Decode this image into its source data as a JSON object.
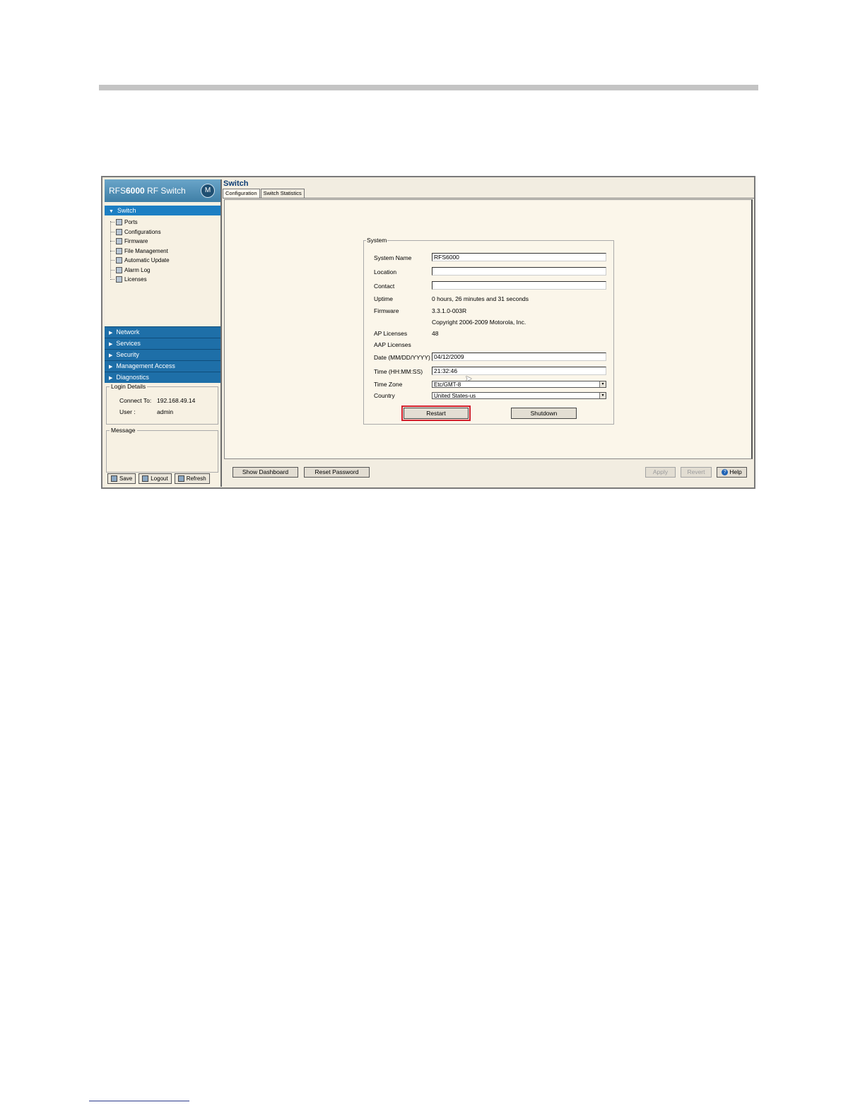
{
  "brand": {
    "prefix": "RFS",
    "model": "6000",
    "suffix": " RF Switch",
    "logo": "M"
  },
  "nav": {
    "active": "Switch",
    "tree": [
      {
        "label": "Ports",
        "icon": "ports-icon"
      },
      {
        "label": "Configurations",
        "icon": "configurations-icon"
      },
      {
        "label": "Firmware",
        "icon": "firmware-icon"
      },
      {
        "label": "File Management",
        "icon": "file-management-icon"
      },
      {
        "label": "Automatic Update",
        "icon": "automatic-update-icon"
      },
      {
        "label": "Alarm Log",
        "icon": "alarm-log-icon"
      },
      {
        "label": "Licenses",
        "icon": "licenses-icon"
      }
    ],
    "groups": [
      "Network",
      "Services",
      "Security",
      "Management Access",
      "Diagnostics"
    ]
  },
  "login": {
    "legend": "Login Details",
    "connect_label": "Connect To:",
    "connect_value": "192.168.49.14",
    "user_label": "User :",
    "user_value": "admin"
  },
  "message": {
    "legend": "Message"
  },
  "left_buttons": {
    "save": "Save",
    "logout": "Logout",
    "refresh": "Refresh"
  },
  "page": {
    "title": "Switch",
    "tabs": [
      "Configuration",
      "Switch Statistics"
    ]
  },
  "system": {
    "legend": "System",
    "system_name_label": "System Name",
    "system_name_value": "RFS6000",
    "location_label": "Location",
    "location_value": "",
    "contact_label": "Contact",
    "contact_value": "",
    "uptime_label": "Uptime",
    "uptime_value": "0 hours, 26 minutes and 31 seconds",
    "firmware_label": "Firmware",
    "firmware_value": "3.3.1.0-003R",
    "copyright": "Copyright 2006-2009 Motorola, Inc.",
    "ap_licenses_label": "AP Licenses",
    "ap_licenses_value": "48",
    "aap_licenses_label": "AAP Licenses",
    "date_label": "Date (MM/DD/YYYY)",
    "date_value": "04/12/2009",
    "time_label": "Time (HH:MM:SS)",
    "time_value": "21:32:46",
    "timezone_label": "Time Zone",
    "timezone_value": "Etc/GMT-8",
    "country_label": "Country",
    "country_value": "United States-us",
    "restart": "Restart",
    "shutdown": "Shutdown"
  },
  "bottom": {
    "show_dashboard": "Show Dashboard",
    "reset_password": "Reset Password",
    "apply": "Apply",
    "revert": "Revert",
    "help": "Help"
  },
  "colors": {
    "highlight": "#d21f2b",
    "nav_active": "#1c7fc3",
    "nav_group": "#1e6fa8"
  }
}
